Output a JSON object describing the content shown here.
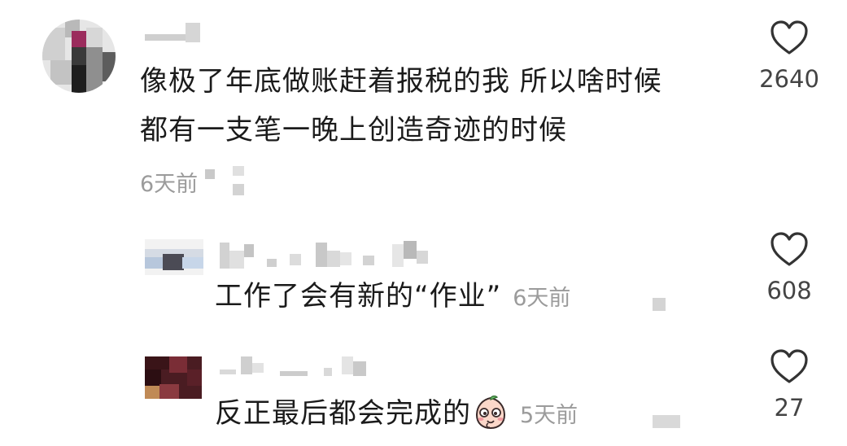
{
  "comments": [
    {
      "text_line1": "像极了年底做账赶着报税的我 所以啥时候",
      "text_line2": "都有一支笔一晚上创造奇迹的时候",
      "time": "6天前",
      "likes": "2640"
    },
    {
      "text": "工作了会有新的“作业”",
      "time": "6天前",
      "likes": "608"
    },
    {
      "text": "反正最后都会完成的",
      "time": "5天前",
      "likes": "27",
      "emoji": "shy-peach-emoji"
    }
  ],
  "icons": {
    "like": "heart-outline-icon"
  },
  "colors": {
    "text": "#1b1b1b",
    "meta": "#9b9b9b",
    "count": "#444444"
  }
}
